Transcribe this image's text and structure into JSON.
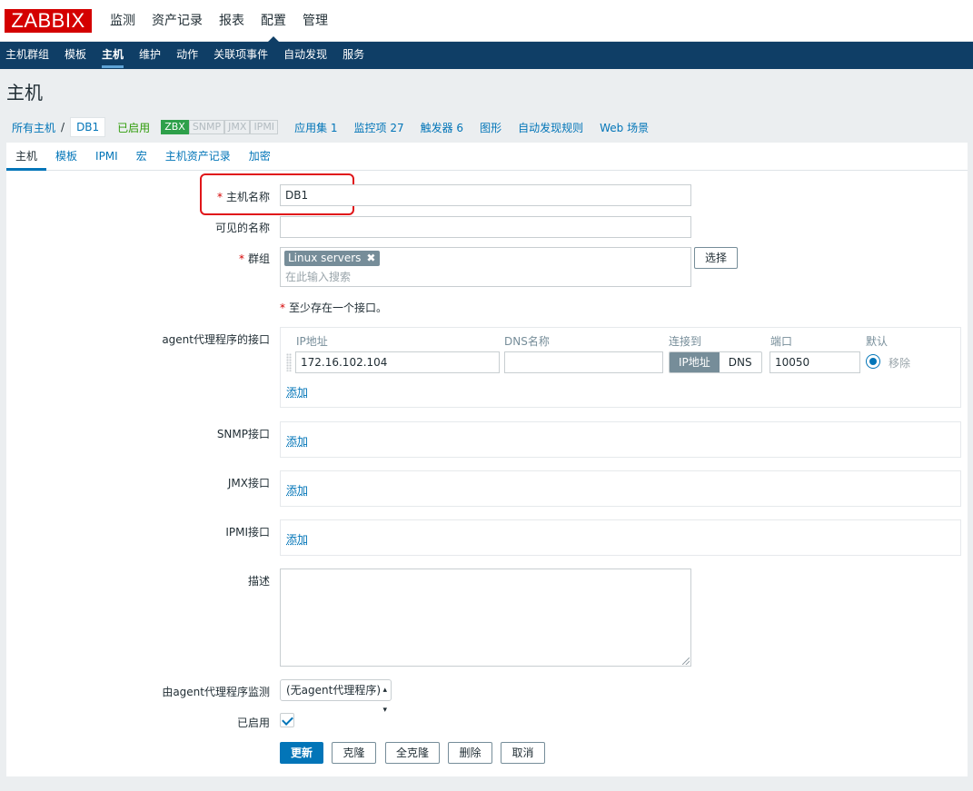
{
  "logo": "ZABBIX",
  "main_nav": [
    "监测",
    "资产记录",
    "报表",
    "配置",
    "管理"
  ],
  "sub_nav": [
    "主机群组",
    "模板",
    "主机",
    "维护",
    "动作",
    "关联项事件",
    "自动发现",
    "服务"
  ],
  "page_title": "主机",
  "host_nav": {
    "all_hosts": "所有主机",
    "separator": "/",
    "current_host": "DB1",
    "status": "已启用",
    "availability": [
      "ZBX",
      "SNMP",
      "JMX",
      "IPMI"
    ],
    "applications": "应用集 1",
    "items": "监控项 27",
    "triggers": "触发器 6",
    "graphs": "图形",
    "discovery": "自动发现规则",
    "web": "Web 场景"
  },
  "tabs": [
    "主机",
    "模板",
    "IPMI",
    "宏",
    "主机资产记录",
    "加密"
  ],
  "form": {
    "host_name_label": "主机名称",
    "host_name_value": "DB1",
    "visible_name_label": "可见的名称",
    "visible_name_value": "",
    "groups_label": "群组",
    "group_chip": "Linux servers",
    "chip_remove": "✖",
    "groups_placeholder": "在此输入搜索",
    "select_button": "选择",
    "required_mark": "*",
    "interface_note": "至少存在一个接口。",
    "agent_label": "agent代理程序的接口",
    "col_ip": "IP地址",
    "col_dns": "DNS名称",
    "col_connect": "连接到",
    "col_port": "端口",
    "col_default": "默认",
    "ip_value": "172.16.102.104",
    "dns_value": "",
    "connect_ip": "IP地址",
    "connect_dns": "DNS",
    "port_value": "10050",
    "remove": "移除",
    "add": "添加",
    "snmp_label": "SNMP接口",
    "jmx_label": "JMX接口",
    "ipmi_label": "IPMI接口",
    "description_label": "描述",
    "proxy_label": "由agent代理程序监测",
    "proxy_value": "(无agent代理程序)",
    "enabled_label": "已启用",
    "buttons": {
      "update": "更新",
      "clone": "克隆",
      "full_clone": "全克隆",
      "delete": "删除",
      "cancel": "取消"
    }
  }
}
